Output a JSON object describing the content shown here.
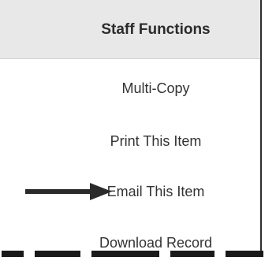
{
  "panel": {
    "title": "Staff Functions",
    "items": [
      {
        "label": "Multi-Copy"
      },
      {
        "label": "Print This Item"
      },
      {
        "label": "Email This Item"
      },
      {
        "label": "Download Record"
      }
    ]
  },
  "annotation": {
    "icon": "arrow-right-icon",
    "color": "#2a2a2a"
  }
}
